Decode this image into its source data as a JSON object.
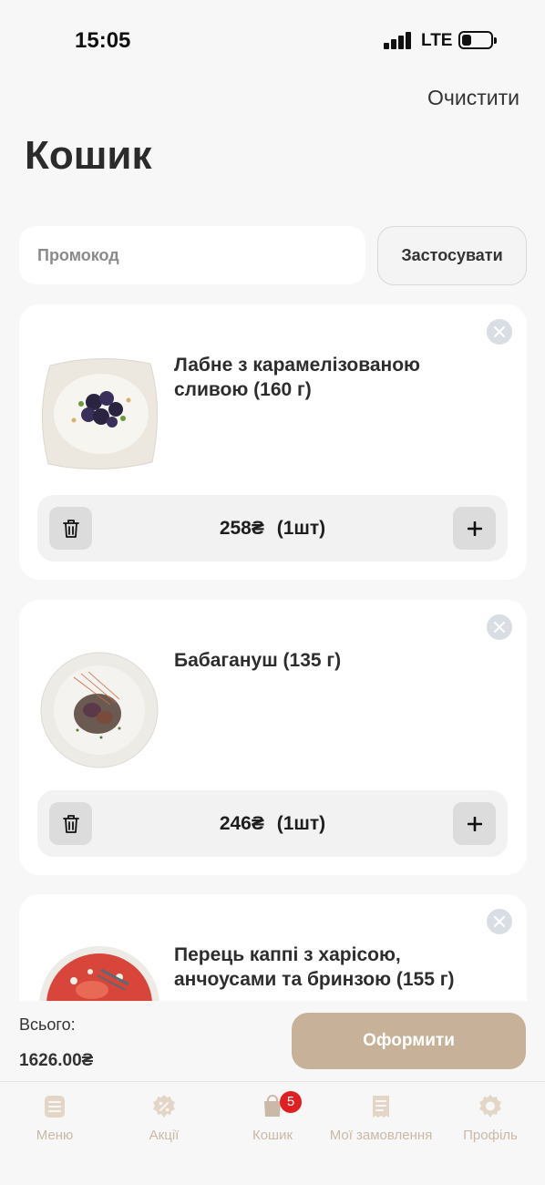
{
  "status_bar": {
    "time": "15:05",
    "network": "LTE"
  },
  "header": {
    "clear_label": "Очистити",
    "title": "Кошик"
  },
  "promo": {
    "placeholder": "Промокод",
    "apply_label": "Застосувати"
  },
  "cart_items": [
    {
      "name": "Лабне з карамелізованою сливою (160 г)",
      "price": "258₴",
      "qty": "(1шт)"
    },
    {
      "name": "Бабагануш (135 г)",
      "price": "246₴",
      "qty": "(1шт)"
    },
    {
      "name": "Перець каппі з харісою, анчоусами та бринзою (155 г)",
      "price": "",
      "qty": ""
    }
  ],
  "summary": {
    "total_label": "Всього:",
    "total_value": "1626.00₴",
    "checkout_label": "Оформити"
  },
  "tab_bar": {
    "items": [
      {
        "label": "Меню",
        "icon": "menu-icon"
      },
      {
        "label": "Акції",
        "icon": "discount-icon"
      },
      {
        "label": "Кошик",
        "icon": "cart-icon",
        "badge": "5",
        "active": true
      },
      {
        "label": "Мої замовлення",
        "icon": "receipt-icon"
      },
      {
        "label": "Профіль",
        "icon": "profile-icon"
      }
    ]
  },
  "colors": {
    "accent": "#c7b299",
    "tab_inactive": "#c9b9a6",
    "badge": "#e02020",
    "background": "#f7f7f7"
  }
}
